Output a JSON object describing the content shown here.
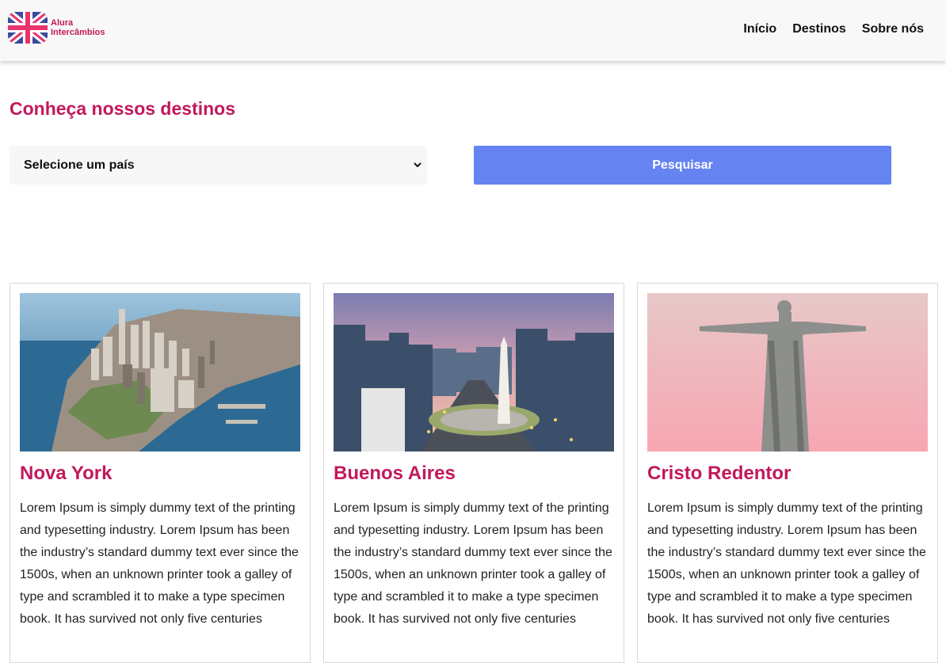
{
  "header": {
    "logo": {
      "line1": "Alura",
      "line2": "Intercâmbios"
    },
    "nav": [
      {
        "label": "Início"
      },
      {
        "label": "Destinos"
      },
      {
        "label": "Sobre nós"
      }
    ]
  },
  "main": {
    "title": "Conheça nossos destinos",
    "country_select": {
      "value": "Selecione um país"
    },
    "search_button": {
      "label": "Pesquisar"
    },
    "cards": [
      {
        "title": "Nova York",
        "image": "new-york-aerial-photo",
        "text": "Lorem Ipsum is simply dummy text of the printing and typesetting industry. Lorem Ipsum has been the industry’s standard dummy text ever since the 1500s, when an unknown printer took a galley of type and scrambled it to make a type specimen book. It has survived not only five centuries"
      },
      {
        "title": "Buenos Aires",
        "image": "buenos-aires-obelisk-photo",
        "text": "Lorem Ipsum is simply dummy text of the printing and typesetting industry. Lorem Ipsum has been the industry’s standard dummy text ever since the 1500s, when an unknown printer took a galley of type and scrambled it to make a type specimen book. It has survived not only five centuries"
      },
      {
        "title": "Cristo Redentor",
        "image": "christ-the-redeemer-photo",
        "text": "Lorem Ipsum is simply dummy text of the printing and typesetting industry. Lorem Ipsum has been the industry’s standard dummy text ever since the 1500s, when an unknown printer took a galley of type and scrambled it to make a type specimen book. It has survived not only five centuries"
      }
    ]
  },
  "colors": {
    "brand_pink": "#c2185b",
    "button_blue": "#6583f1",
    "header_bg": "#f8f8f8"
  }
}
